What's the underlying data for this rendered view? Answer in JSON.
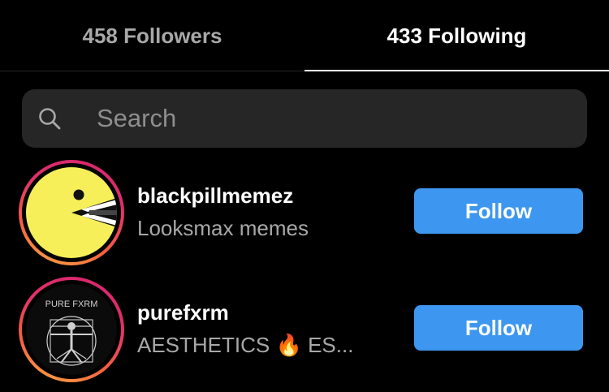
{
  "tabs": {
    "followers_label": "458 Followers",
    "following_label": "433 Following",
    "active": "following"
  },
  "search": {
    "placeholder": "Search",
    "value": ""
  },
  "accounts": [
    {
      "username": "blackpillmemez",
      "subtitle": "Looksmax memes",
      "button_label": "Follow",
      "avatar": "pacman-icon"
    },
    {
      "username": "purefxrm",
      "subtitle": "AESTHETICS 🔥 ES...",
      "button_label": "Follow",
      "avatar": "vitruvian-man-logo",
      "avatar_text": "PURE FXRM"
    }
  ],
  "colors": {
    "background": "#000000",
    "search_bg": "#262626",
    "button": "#3d97f0",
    "muted_text": "#a8a8a8"
  }
}
